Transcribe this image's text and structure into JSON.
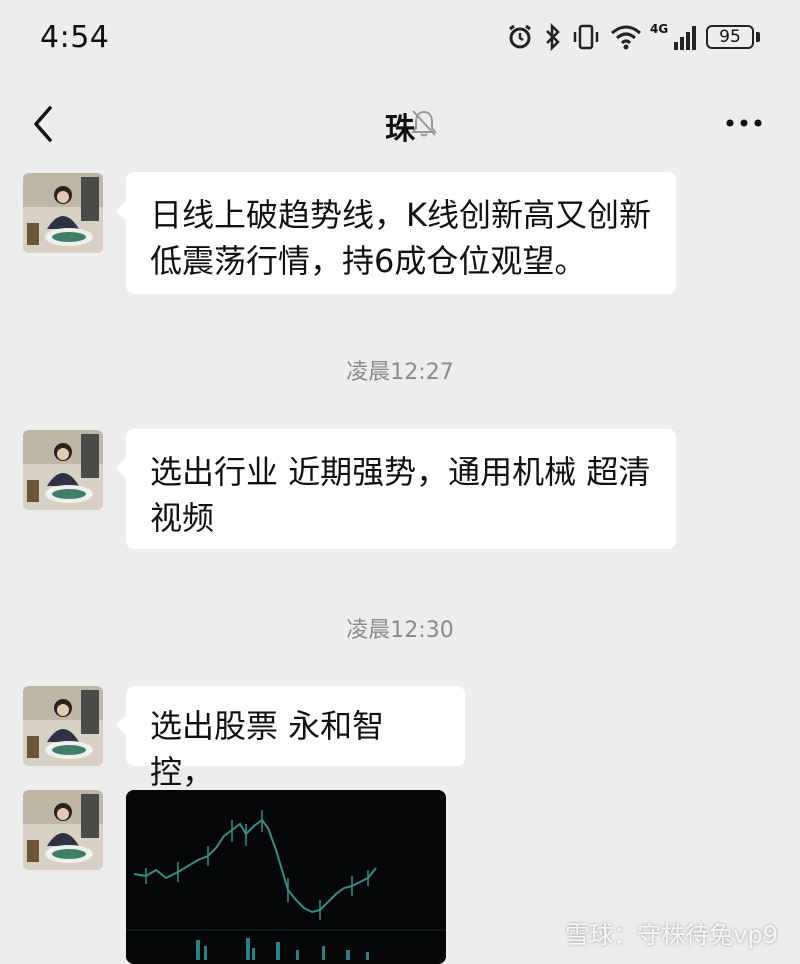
{
  "status_bar": {
    "time": "4:54",
    "network": "4G",
    "battery": "95",
    "icons": [
      "alarm-icon",
      "bluetooth-icon",
      "vibrate-icon",
      "wifi-icon",
      "signal-icon",
      "battery-icon"
    ]
  },
  "nav": {
    "title": "珠",
    "back_icon": "chevron-left-icon",
    "mute_icon": "bell-muted-icon",
    "more_icon": "more-horizontal-icon"
  },
  "messages": [
    {
      "type": "text",
      "text": "日线上破趋势线，K线创新高又创新低震荡行情，持6成仓位观望。"
    },
    {
      "type": "timestamp",
      "text": "凌晨12:27"
    },
    {
      "type": "text",
      "text": "选出行业  近期强势，通用机械 超清视频"
    },
    {
      "type": "timestamp",
      "text": "凌晨12:30"
    },
    {
      "type": "text",
      "text": "选出股票 永和智控，"
    },
    {
      "type": "image",
      "description_icon": "stock-chart-image"
    }
  ],
  "watermark": "雪球：守株待兔vp9",
  "colors": {
    "background": "#ededed",
    "bubble": "#ffffff",
    "timestamp": "#8a8a8a"
  }
}
